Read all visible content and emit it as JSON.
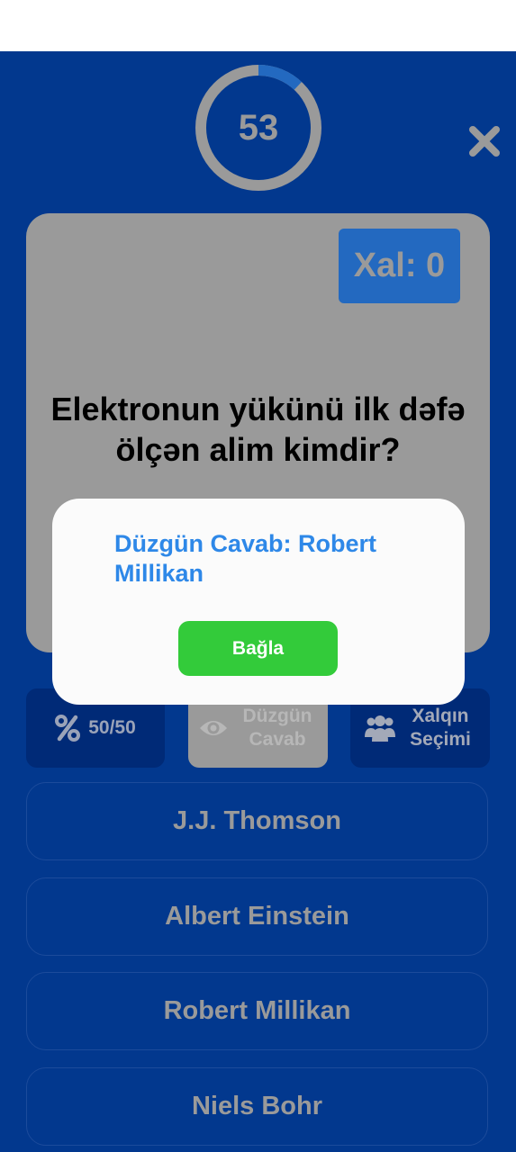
{
  "timer": {
    "value": "53",
    "remaining_fraction": 0.12
  },
  "score": {
    "label": "Xal: 0"
  },
  "question": {
    "text": "Elektronun yükünü ilk dəfə ölçən alim kimdir?"
  },
  "dialog": {
    "message": "Düzgün Cavab: Robert Millikan",
    "button_label": "Bağla"
  },
  "lifelines": [
    {
      "label": "50/50",
      "icon": "percent-icon"
    },
    {
      "label": "Düzgün Cavab",
      "icon": "eye-icon"
    },
    {
      "label": "Xalqın Seçimi",
      "icon": "users-icon"
    }
  ],
  "answers": [
    "J.J. Thomson",
    "Albert Einstein",
    "Robert Millikan",
    "Niels Bohr"
  ],
  "colors": {
    "background": "#02388e",
    "card": "#9a9a9a",
    "accent_blue": "#2369c0",
    "dialog_text": "#2e88e8",
    "button_green": "#33cb3a",
    "lifeline_dark": "#002a77"
  }
}
